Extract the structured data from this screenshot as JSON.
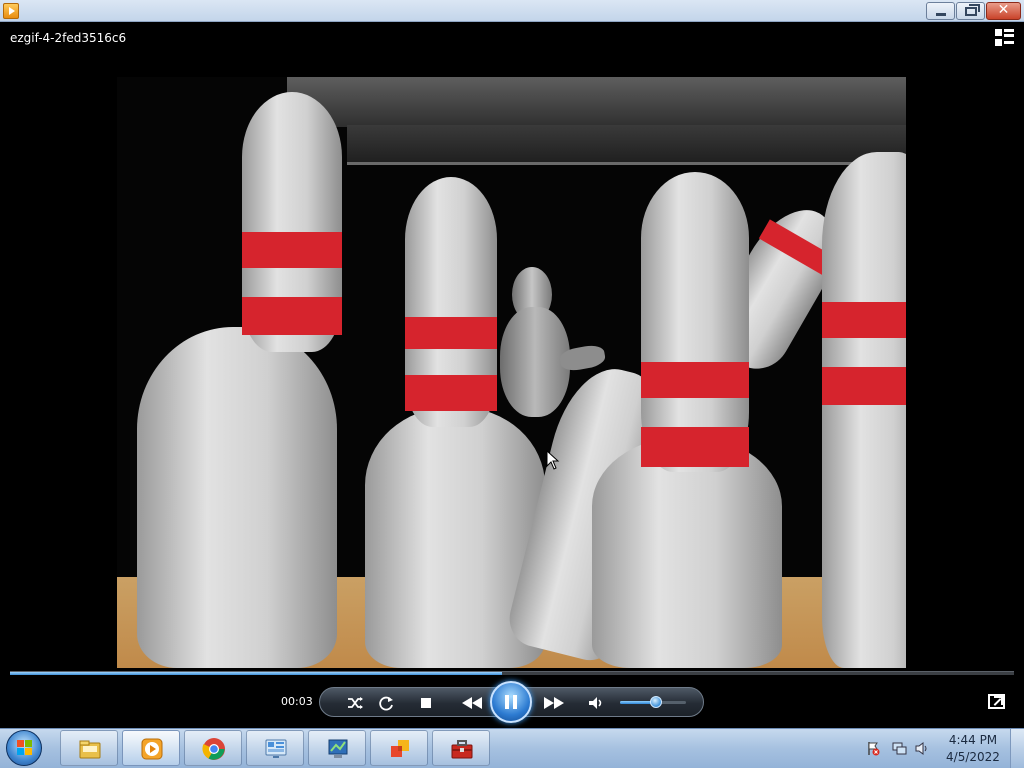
{
  "window": {
    "title": "Windows Media Player",
    "controls": [
      "minimize",
      "maximize",
      "close"
    ],
    "close_glyph": "✕"
  },
  "player": {
    "media_title": "ezgif-4-2fed3516c6",
    "elapsed_time": "00:03",
    "playback_state": "playing",
    "seek_progress": 0.49,
    "volume_level": 0.55,
    "icons": [
      "switch-to-library-icon",
      "shuffle-icon",
      "repeat-icon",
      "stop-icon",
      "previous-icon",
      "pause-icon",
      "next-icon",
      "volume-icon",
      "fullscreen-icon"
    ]
  },
  "taskbar": {
    "start_label": "Start",
    "pinned": [
      "windows-explorer-icon",
      "windows-media-player-icon",
      "google-chrome-icon",
      "control-panel-icon",
      "remote-desktop-icon",
      "app-icon",
      "toolbox-icon"
    ],
    "tray_icons": [
      "action-center-alert-icon",
      "network-icon",
      "speaker-icon"
    ],
    "clock_time": "4:44 PM",
    "clock_date": "4/5/2022"
  },
  "colors": {
    "accent_blue": "#2d7bd1",
    "pin_stripe_red": "#d6242d",
    "taskbar": "#a6c1e0"
  }
}
